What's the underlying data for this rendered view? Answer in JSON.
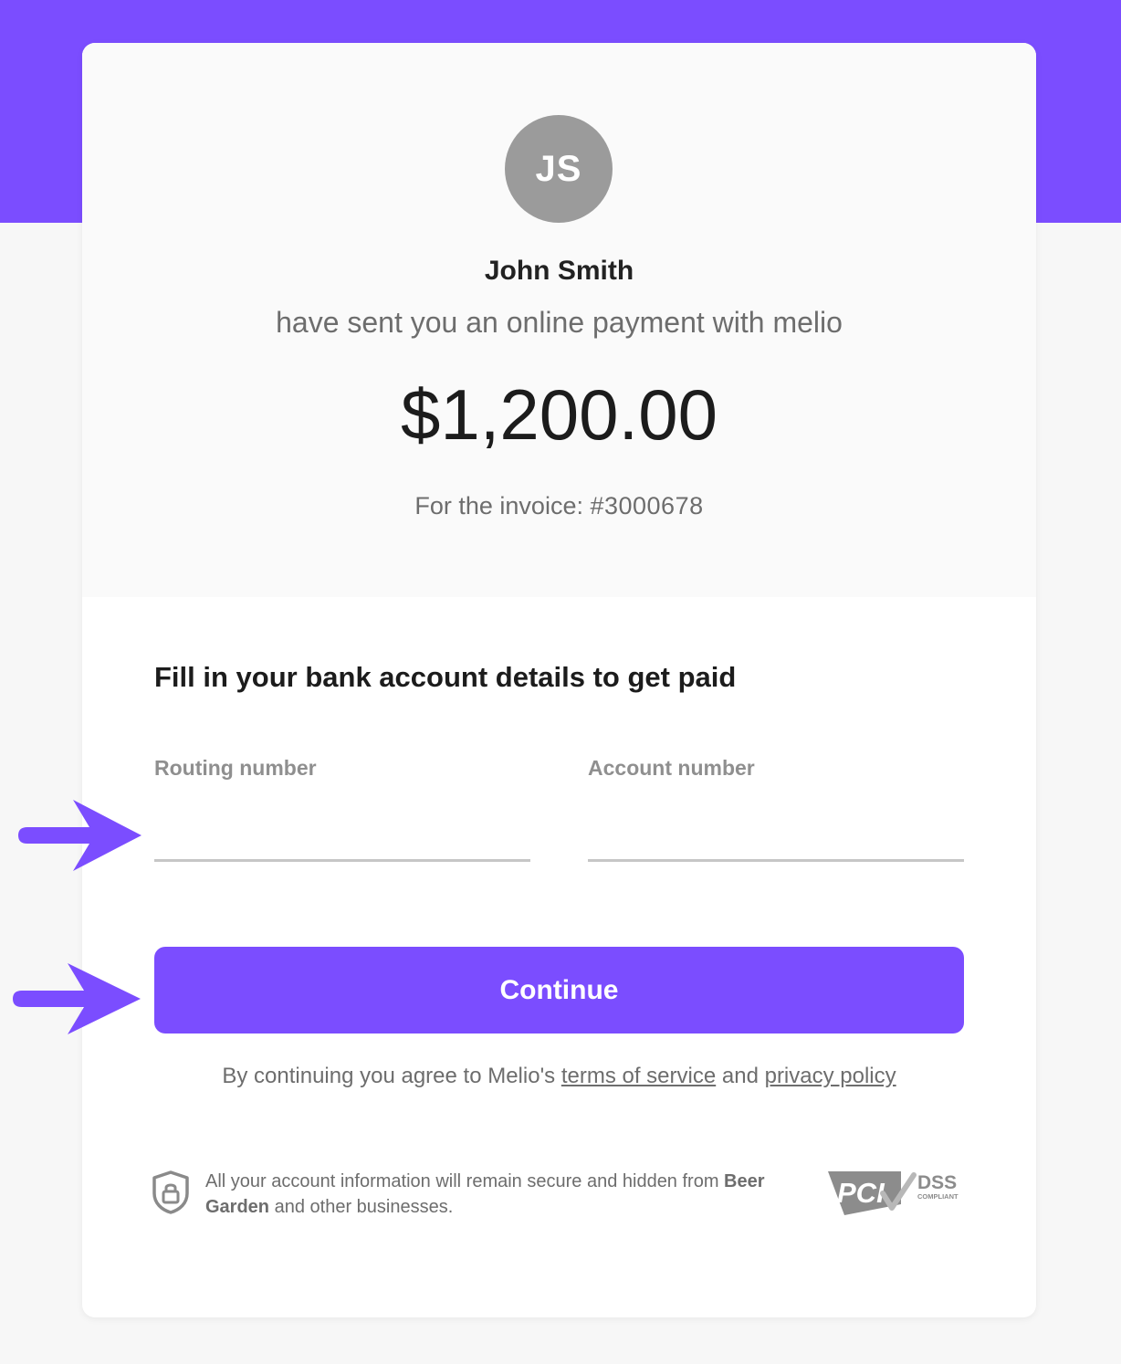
{
  "header": {
    "avatar_initials": "JS",
    "sender_name": "John Smith",
    "subtitle": "have sent you an online payment with melio",
    "amount": "$1,200.00",
    "invoice_prefix": "For the invoice: ",
    "invoice_number": "#3000678"
  },
  "form": {
    "title": "Fill in your bank account details to get paid",
    "routing_label": "Routing number",
    "routing_value": "",
    "account_label": "Account number",
    "account_value": "",
    "continue_label": "Continue"
  },
  "terms": {
    "prefix": "By continuing you agree to Melio's ",
    "terms_link": "terms of service",
    "and": " and ",
    "privacy_link": "privacy policy"
  },
  "security": {
    "text_prefix": "All your account information will remain secure and hidden from ",
    "business_name": "Beer Garden",
    "text_suffix": " and other businesses.",
    "pci_text": "PCI",
    "dss_text": "DSS",
    "compliant_text": "COMPLIANT"
  },
  "colors": {
    "brand": "#7b4dff",
    "avatar": "#9b9b9b",
    "text_muted": "#6d6d6d"
  },
  "icons": [
    "lock-shield-icon",
    "pci-dss-logo",
    "pointer-arrow-icon"
  ]
}
